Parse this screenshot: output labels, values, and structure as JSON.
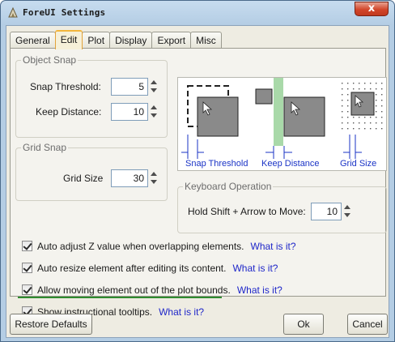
{
  "window": {
    "title": "ForeUI Settings",
    "close_label": "x"
  },
  "tabs": [
    {
      "label": "General",
      "active": false
    },
    {
      "label": "Edit",
      "active": true
    },
    {
      "label": "Plot",
      "active": false
    },
    {
      "label": "Display",
      "active": false
    },
    {
      "label": "Export",
      "active": false
    },
    {
      "label": "Misc",
      "active": false
    }
  ],
  "object_snap": {
    "title": "Object Snap",
    "snap_threshold_label": "Snap Threshold:",
    "snap_threshold_value": "5",
    "keep_distance_label": "Keep Distance:",
    "keep_distance_value": "10"
  },
  "grid_snap": {
    "title": "Grid Snap",
    "grid_size_label": "Grid Size",
    "grid_size_value": "30"
  },
  "illustration": {
    "snap_threshold": "Snap Threshold",
    "keep_distance": "Keep Distance",
    "grid_size": "Grid Size"
  },
  "keyboard": {
    "title": "Keyboard Operation",
    "label": "Hold Shift + Arrow to Move:",
    "value": "10"
  },
  "options": [
    {
      "text": "Auto adjust Z value when overlapping elements.",
      "link": "What is it?",
      "checked": true
    },
    {
      "text": "Auto resize element after editing its content.",
      "link": "What is it?",
      "checked": true
    },
    {
      "text": "Allow moving element out of the plot bounds.",
      "link": "What is it?",
      "checked": true
    },
    {
      "text": "Show instructional tooltips.",
      "link": "What is it?",
      "checked": true
    }
  ],
  "buttons": {
    "restore": "Restore Defaults",
    "ok": "Ok",
    "cancel": "Cancel"
  },
  "colors": {
    "link": "#1f27c9",
    "accent_tab": "#f3b63b",
    "highlight_line": "#2e8b2e",
    "illustration_label": "#1a33c6"
  }
}
